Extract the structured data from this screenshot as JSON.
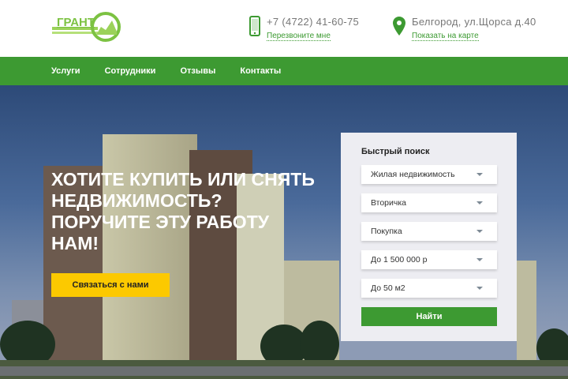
{
  "header": {
    "logo_text": "ГРАНТ",
    "phone": "+7 (4722) 41-60-75",
    "callback_link": "Перезвоните мне",
    "address": "Белгород, ул.Щорса д.40",
    "map_link": "Показать на карте"
  },
  "nav": {
    "items": [
      {
        "label": "Услуги"
      },
      {
        "label": "Сотрудники"
      },
      {
        "label": "Отзывы"
      },
      {
        "label": "Контакты"
      }
    ]
  },
  "hero": {
    "headline": "Хотите купить или снять недвижимость? Поручите эту работу нам!",
    "cta_label": "Связаться с нами"
  },
  "search": {
    "title": "Быстрый поиск",
    "selects": [
      {
        "value": "Жилая недвижимость"
      },
      {
        "value": "Вторичка"
      },
      {
        "value": "Покупка"
      },
      {
        "value": "До 1 500 000 р"
      },
      {
        "value": "До 50 м2"
      }
    ],
    "submit_label": "Найти"
  },
  "colors": {
    "brand_green": "#3d9a32",
    "logo_green": "#7cc242",
    "cta_yellow": "#fcc900"
  }
}
